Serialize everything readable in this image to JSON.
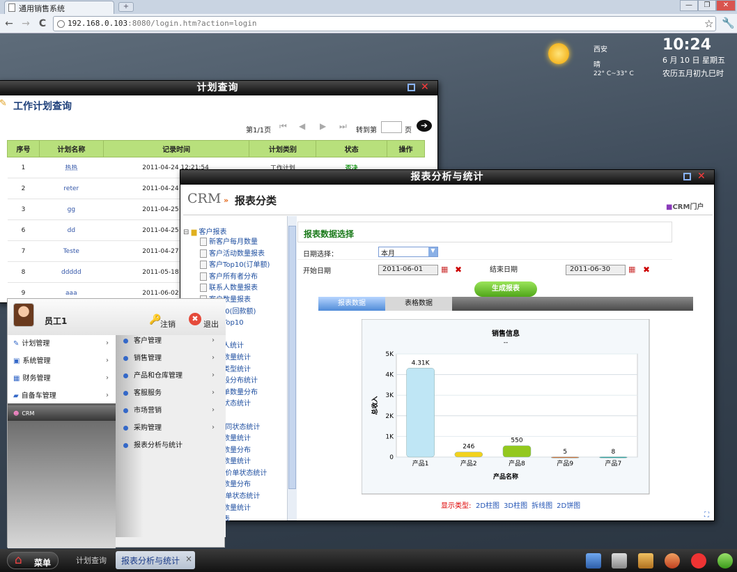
{
  "browser": {
    "tab_title": "通用销售系统",
    "url_host": "192.168.0.103",
    "url_rest": ":8080/login.htm?action=login",
    "new_tab": "+",
    "min": "—",
    "max": "❐",
    "close": "✕",
    "back": "←",
    "forward": "→",
    "reload": "C",
    "star": "☆",
    "wrench": "🔧"
  },
  "weather": {
    "city": "西安",
    "condition": "晴",
    "temp": "22° C~33° C"
  },
  "clock": {
    "time": "10:24",
    "date": "6 月 10 日 星期五",
    "lunar": "农历五月初九巳时"
  },
  "plan_window": {
    "title": "计划查询",
    "heading": "工作计划查询",
    "page_info": "第1/1页",
    "goto_label": "转到第",
    "page_unit": "页",
    "columns": [
      "序号",
      "计划名称",
      "记录时间",
      "计划类别",
      "状态",
      "操作"
    ],
    "rows": [
      {
        "no": "1",
        "name": "热热",
        "time": "2011-04-24 12:21:54",
        "type": "工作计划",
        "status": "否决"
      },
      {
        "no": "2",
        "name": "reter",
        "time": "2011-04-24",
        "type": "",
        "status": ""
      },
      {
        "no": "3",
        "name": "gg",
        "time": "2011-04-25",
        "type": "",
        "status": ""
      },
      {
        "no": "6",
        "name": "dd",
        "time": "2011-04-25",
        "type": "",
        "status": ""
      },
      {
        "no": "7",
        "name": "Teste",
        "time": "2011-04-27",
        "type": "",
        "status": ""
      },
      {
        "no": "8",
        "name": "ddddd",
        "time": "2011-05-18",
        "type": "",
        "status": ""
      },
      {
        "no": "9",
        "name": "aaa",
        "time": "2011-06-02",
        "type": "",
        "status": ""
      }
    ]
  },
  "report_window": {
    "title": "报表分析与统计",
    "logo": "CRM",
    "category_title": "报表分类",
    "portal": "CRM门户",
    "tree_root": "客户报表",
    "tree_items": [
      "新客户每月数量",
      "客户活动数量报表",
      "客户Top10(订单额)",
      "客户所有者分布",
      "联系人数量报表",
      "客户数量报表",
      "Top10(回款额)",
      "活动Top10",
      "表",
      "负责人统计",
      "状态数量统计",
      "活动类型统计",
      "单阶段分布统计",
      "报价单数量分布",
      "活动状态统计",
      "统计",
      "员/合同状态统计",
      "状态数量统计",
      "订单数量分布",
      "状态数量统计",
      "人/报价单状态统计",
      "机会数量分布",
      "人/订单状态统计",
      "来源数量统计",
      "各报表"
    ],
    "form_title": "报表数据选择",
    "date_select_label": "日期选择：",
    "date_select_value": "本月",
    "start_label": "开始日期",
    "start_value": "2011-06-01",
    "end_label": "结束日期",
    "end_value": "2011-06-30",
    "generate": "生成报表",
    "tab_chart": "报表数据",
    "tab_table": "表格数据",
    "display_label": "显示类型:",
    "display_options": [
      "2D柱图",
      "3D柱图",
      "拆线图",
      "2D饼图"
    ]
  },
  "chart_data": {
    "type": "bar",
    "title": "销售信息",
    "subtitle": "--",
    "xlabel": "产品名称",
    "ylabel": "总收入",
    "categories": [
      "产品1",
      "产品2",
      "产品8",
      "产品9",
      "产品7"
    ],
    "values": [
      4310,
      246,
      550,
      5,
      8
    ],
    "value_labels": [
      "4.31K",
      "246",
      "550",
      "5",
      "8"
    ],
    "ylim": [
      0,
      5000
    ],
    "yticks": [
      "0",
      "1K",
      "2K",
      "3K",
      "4K",
      "5K"
    ],
    "colors": [
      "#bfe6f5",
      "#f2d21e",
      "#93c81e",
      "#d8692a",
      "#2fa3a0"
    ]
  },
  "start_menu": {
    "user": "员工1",
    "logout": "注销",
    "exit": "退出",
    "left_items": [
      "计划管理",
      "系统管理",
      "财务管理",
      "自备车管理",
      "CRM"
    ],
    "sub_items": [
      "客户管理",
      "销售管理",
      "产品和仓库管理",
      "客服服务",
      "市场营销",
      "采购管理",
      "报表分析与统计"
    ]
  },
  "taskbar": {
    "start": "菜单",
    "tasks": [
      "计划查询",
      "报表分析与统计"
    ],
    "task_close": "×"
  }
}
